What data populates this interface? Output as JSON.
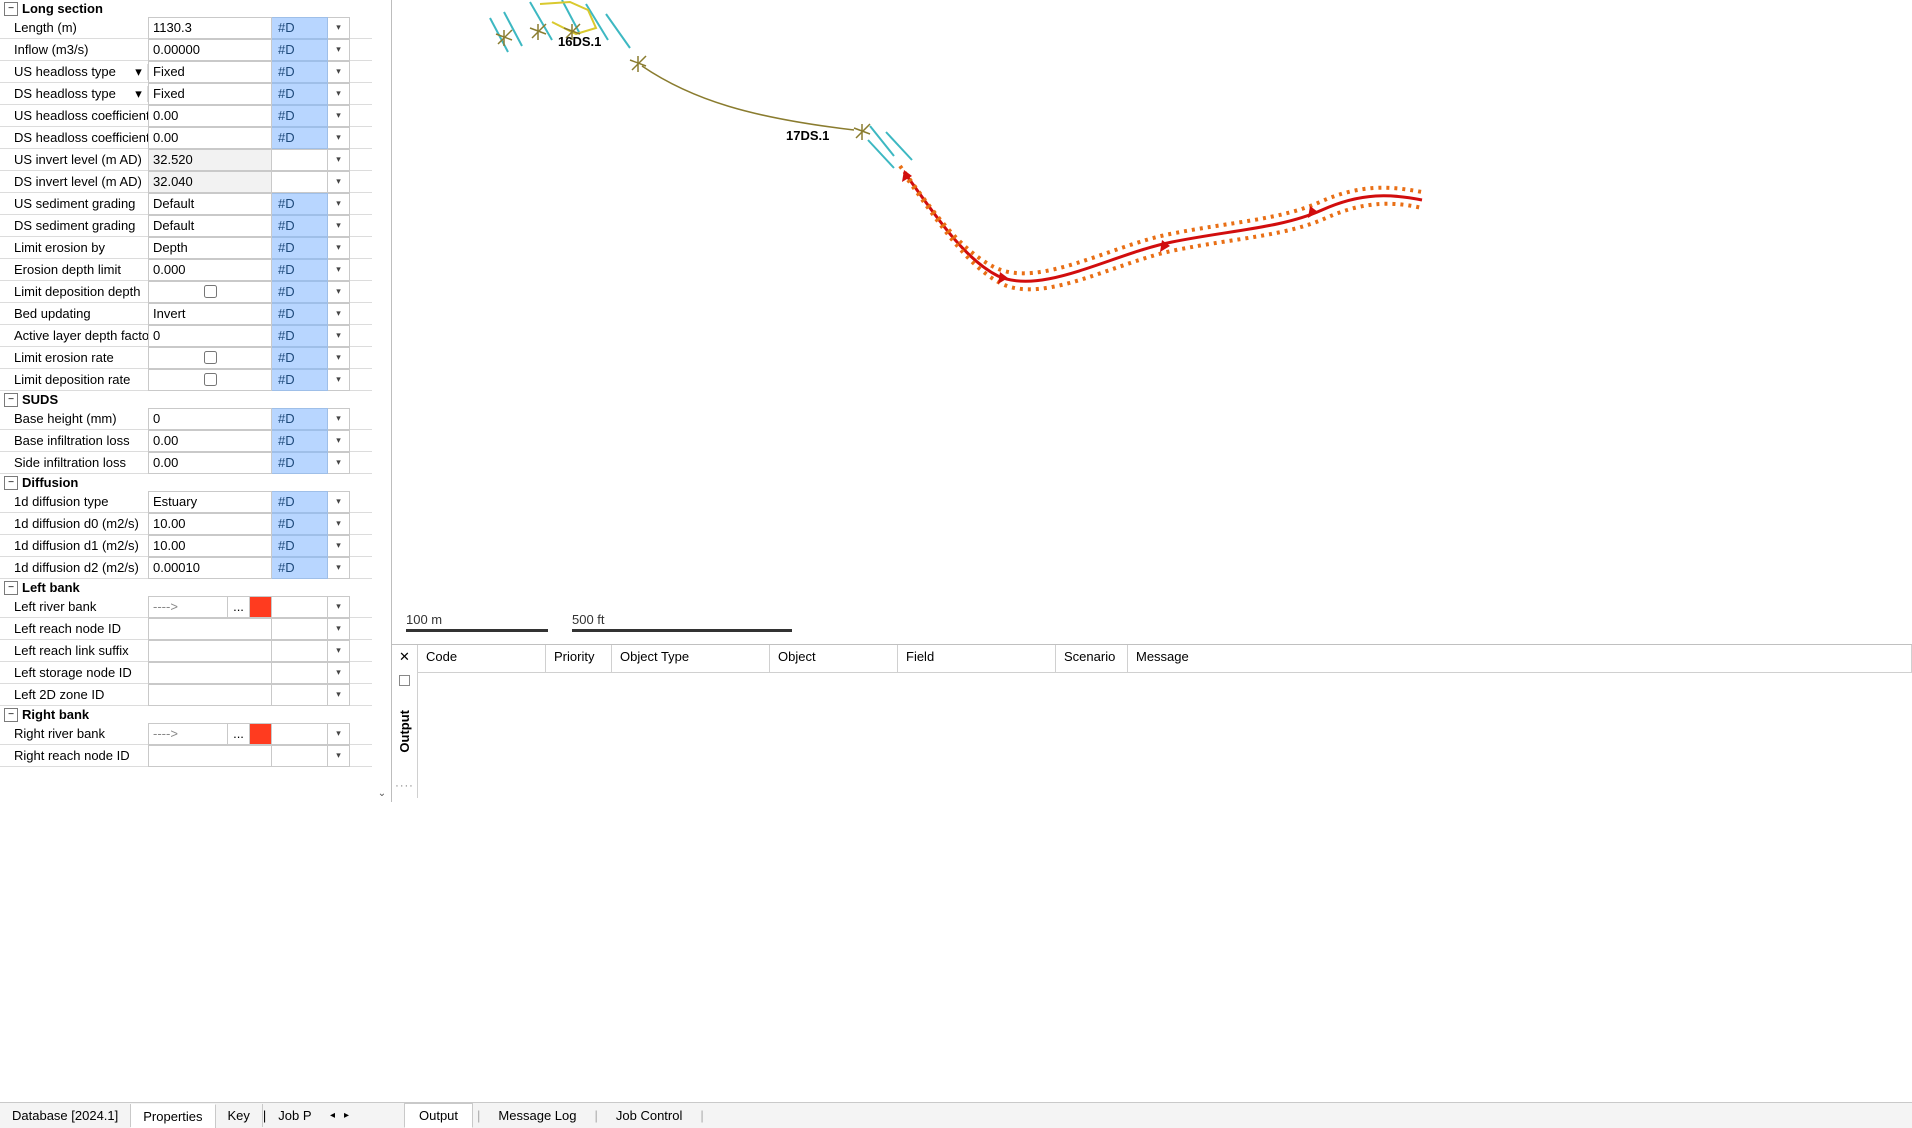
{
  "sections": {
    "long_section": {
      "title": "Long section",
      "rows": [
        {
          "label": "Length (m)",
          "value": "1130.3",
          "flag": "#D"
        },
        {
          "label": "Inflow (m3/s)",
          "value": "0.00000",
          "flag": "#D"
        },
        {
          "label": "US headloss type",
          "value": "Fixed",
          "flag": "#D",
          "has_type": true
        },
        {
          "label": "DS headloss type",
          "value": "Fixed",
          "flag": "#D",
          "has_type": true
        },
        {
          "label": "US headloss coefficient",
          "value": "0.00",
          "flag": "#D"
        },
        {
          "label": "DS headloss coefficient",
          "value": "0.00",
          "flag": "#D"
        },
        {
          "label": "US invert level (m AD)",
          "value": "32.520",
          "flag": "",
          "readonly": true
        },
        {
          "label": "DS invert level (m AD)",
          "value": "32.040",
          "flag": "",
          "readonly": true
        },
        {
          "label": "US sediment grading",
          "value": "Default",
          "flag": "#D"
        },
        {
          "label": "DS sediment grading",
          "value": "Default",
          "flag": "#D"
        },
        {
          "label": "Limit erosion by",
          "value": "Depth",
          "flag": "#D"
        },
        {
          "label": "Erosion depth limit",
          "value": "0.000",
          "flag": "#D"
        },
        {
          "label": "Limit deposition depth",
          "value": "",
          "flag": "#D",
          "checkbox": true
        },
        {
          "label": "Bed updating",
          "value": "Invert",
          "flag": "#D"
        },
        {
          "label": "Active layer depth factor",
          "value": "0",
          "flag": "#D"
        },
        {
          "label": "Limit erosion rate",
          "value": "",
          "flag": "#D",
          "checkbox": true
        },
        {
          "label": "Limit deposition rate",
          "value": "",
          "flag": "#D",
          "checkbox": true
        }
      ]
    },
    "suds": {
      "title": "SUDS",
      "rows": [
        {
          "label": "Base height (mm)",
          "value": "0",
          "flag": "#D"
        },
        {
          "label": "Base infiltration loss",
          "value": "0.00",
          "flag": "#D"
        },
        {
          "label": "Side infiltration loss",
          "value": "0.00",
          "flag": "#D"
        }
      ]
    },
    "diffusion": {
      "title": "Diffusion",
      "rows": [
        {
          "label": "1d diffusion type",
          "value": "Estuary",
          "flag": "#D"
        },
        {
          "label": "1d diffusion d0 (m2/s)",
          "value": "10.00",
          "flag": "#D"
        },
        {
          "label": "1d diffusion d1 (m2/s)",
          "value": "10.00",
          "flag": "#D"
        },
        {
          "label": "1d diffusion d2 (m2/s)",
          "value": "0.00010",
          "flag": "#D"
        }
      ]
    },
    "left_bank": {
      "title": "Left bank",
      "rows": [
        {
          "label": "Left river bank",
          "bank": true
        },
        {
          "label": "Left reach node ID",
          "value": "",
          "flag": ""
        },
        {
          "label": "Left reach link suffix",
          "value": "",
          "flag": ""
        },
        {
          "label": "Left storage node ID",
          "value": "",
          "flag": ""
        },
        {
          "label": "Left 2D zone ID",
          "value": "",
          "flag": ""
        }
      ]
    },
    "right_bank": {
      "title": "Right bank",
      "rows": [
        {
          "label": "Right river bank",
          "bank": true
        },
        {
          "label": "Right reach node ID",
          "value": "",
          "flag": ""
        }
      ]
    }
  },
  "left_tabs": [
    "Database [2024.1]",
    "Properties",
    "Key",
    "Job P"
  ],
  "left_active_tab": "Properties",
  "right_tabs": [
    "Output",
    "Message Log",
    "Job Control"
  ],
  "right_active_tab": "Output",
  "output": {
    "columns": [
      "Code",
      "Priority",
      "Object Type",
      "Object",
      "Field",
      "Scenario",
      "Message"
    ],
    "side_label": "Output"
  },
  "map": {
    "labels": [
      "16DS.1",
      "17DS.1"
    ],
    "scalebar": [
      {
        "text": "100 m"
      },
      {
        "text": "500 ft"
      }
    ]
  },
  "bank_arrow": "---->",
  "ellipsis": "...",
  "collapse_glyph": "−",
  "type_drop_glyph": "▾"
}
